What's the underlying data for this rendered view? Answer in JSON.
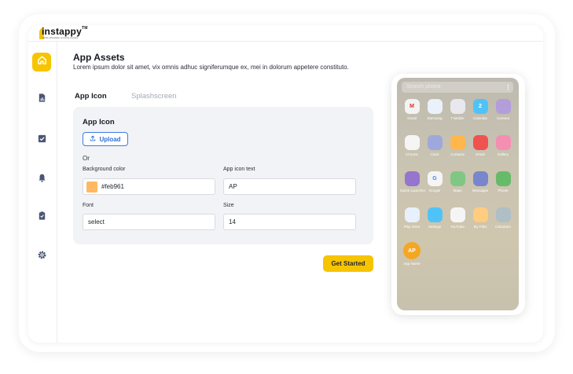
{
  "brand": {
    "name": "instappy",
    "tm": "TM",
    "tagline": "mobile affordable stunning creative"
  },
  "sidebar": {
    "items": [
      {
        "name": "home",
        "icon": "home-icon",
        "active": true
      },
      {
        "name": "reports",
        "icon": "report-icon",
        "active": false
      },
      {
        "name": "tasks",
        "icon": "checkbox-icon",
        "active": false
      },
      {
        "name": "notifications",
        "icon": "bell-icon",
        "active": false
      },
      {
        "name": "clipboard",
        "icon": "clipboard-icon",
        "active": false
      },
      {
        "name": "settings",
        "icon": "gear-icon",
        "active": false
      }
    ]
  },
  "page": {
    "title": "App Assets",
    "subtitle": "Lorem ipsum dolor sit amet, vix omnis adhuc signiferumque ex, mei in dolorum appetere constituto."
  },
  "tabs": [
    {
      "label": "App Icon",
      "active": true
    },
    {
      "label": "Splashscreen",
      "active": false
    }
  ],
  "form": {
    "section_title": "App Icon",
    "upload_label": "Upload",
    "or_label": "Or",
    "background_color": {
      "label": "Background color",
      "value": "#feb961",
      "swatch": "#feb961"
    },
    "app_icon_text": {
      "label": "App icon text",
      "value": "AP"
    },
    "font": {
      "label": "Font",
      "value": "select"
    },
    "size": {
      "label": "Size",
      "value": "14"
    },
    "submit_label": "Get Started"
  },
  "phone": {
    "search_placeholder": "Search phone",
    "apps": [
      {
        "name": "Gmail",
        "color": "#f3f3f3",
        "glyph": "M",
        "glyph_color": "#d93025"
      },
      {
        "name": "Samsung",
        "color": "#eaf1fb",
        "glyph": "",
        "glyph_color": "#4a8af4"
      },
      {
        "name": "T-Mobile",
        "color": "#e8e8ee",
        "glyph": "",
        "glyph_color": "#8a8aa0"
      },
      {
        "name": "Calendar",
        "color": "#4fc3f7",
        "glyph": "2",
        "glyph_color": "#ffffff"
      },
      {
        "name": "Camera",
        "color": "#b39ddb",
        "glyph": "",
        "glyph_color": "#ffffff"
      },
      {
        "name": "Chrome",
        "color": "#f5f5f5",
        "glyph": "",
        "glyph_color": "#4285f4"
      },
      {
        "name": "Clock",
        "color": "#9fa8da",
        "glyph": "",
        "glyph_color": "#ffffff"
      },
      {
        "name": "Contacts",
        "color": "#ffb74d",
        "glyph": "",
        "glyph_color": "#ffffff"
      },
      {
        "name": "Email",
        "color": "#ef5350",
        "glyph": "",
        "glyph_color": "#ffffff"
      },
      {
        "name": "Gallery",
        "color": "#f48fb1",
        "glyph": "",
        "glyph_color": "#ffffff"
      },
      {
        "name": "Game Launcher",
        "color": "#9575cd",
        "glyph": "",
        "glyph_color": "#ffffff"
      },
      {
        "name": "Google",
        "color": "#f5f5f5",
        "glyph": "G",
        "glyph_color": "#4285f4"
      },
      {
        "name": "Maps",
        "color": "#81c784",
        "glyph": "",
        "glyph_color": "#ffffff"
      },
      {
        "name": "Messages",
        "color": "#7986cb",
        "glyph": "",
        "glyph_color": "#ffffff"
      },
      {
        "name": "Phone",
        "color": "#66bb6a",
        "glyph": "",
        "glyph_color": "#ffffff"
      },
      {
        "name": "Play Store",
        "color": "#e8f0fe",
        "glyph": "",
        "glyph_color": "#34a853"
      },
      {
        "name": "Settings",
        "color": "#4fc3f7",
        "glyph": "",
        "glyph_color": "#ffffff"
      },
      {
        "name": "YouTube",
        "color": "#f5f5f5",
        "glyph": "",
        "glyph_color": "#ff0000"
      },
      {
        "name": "My Files",
        "color": "#ffcc80",
        "glyph": "",
        "glyph_color": "#ffffff"
      },
      {
        "name": "Calculator",
        "color": "#b0bec5",
        "glyph": "",
        "glyph_color": "#ffffff"
      }
    ],
    "custom_app": {
      "name": "App Name",
      "icon_text": "AP",
      "color": "#f5a623"
    }
  }
}
